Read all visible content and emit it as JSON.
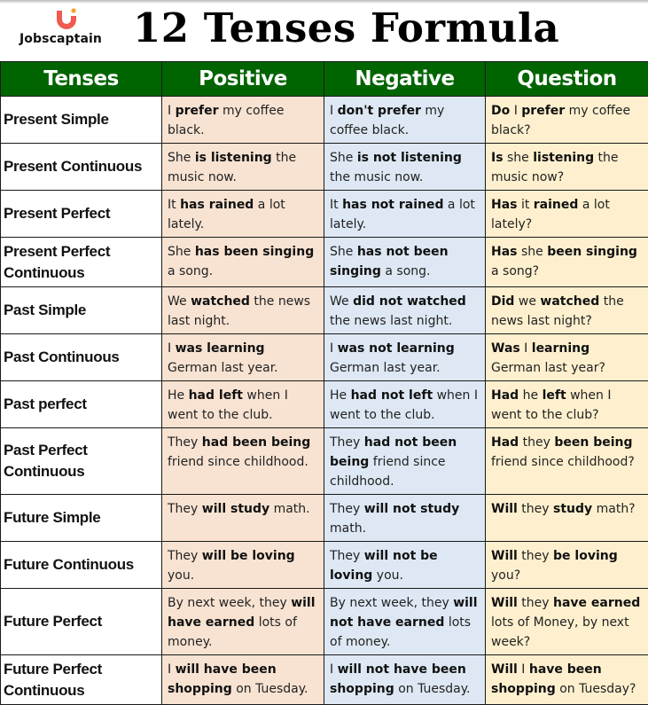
{
  "brand": {
    "name": "Jobscaptain",
    "logo_icon": "jobscaptain-logo-icon",
    "colors": {
      "logo_primary": "#f05a4f",
      "logo_dot": "#f5a623"
    }
  },
  "page": {
    "title": "12 Tenses Formula"
  },
  "colors": {
    "header_bg": "#006400",
    "header_text": "#ffffff",
    "positive_bg": "#f8e3d2",
    "negative_bg": "#dde8f4",
    "question_bg": "#fef0ce"
  },
  "table": {
    "headers": [
      "Tenses",
      "Positive",
      "Negative",
      "Question"
    ],
    "rows": [
      {
        "tense": "Present Simple",
        "positive": [
          {
            "t": "I "
          },
          {
            "b": "prefer"
          },
          {
            "t": " my coffee black."
          }
        ],
        "negative": [
          {
            "t": "I "
          },
          {
            "b": "don't prefer"
          },
          {
            "t": " my coffee black."
          }
        ],
        "question": [
          {
            "b": "Do"
          },
          {
            "t": " I "
          },
          {
            "b": "prefer"
          },
          {
            "t": " my coffee black?"
          }
        ]
      },
      {
        "tense": "Present Continuous",
        "positive": [
          {
            "t": "She "
          },
          {
            "b": "is listening"
          },
          {
            "t": " the music now."
          }
        ],
        "negative": [
          {
            "t": "She "
          },
          {
            "b": "is not listening"
          },
          {
            "t": " the music now."
          }
        ],
        "question": [
          {
            "b": "Is"
          },
          {
            "t": " she "
          },
          {
            "b": "listening"
          },
          {
            "t": " the music now?"
          }
        ]
      },
      {
        "tense": "Present Perfect",
        "positive": [
          {
            "t": "It "
          },
          {
            "b": "has rained"
          },
          {
            "t": " a lot lately."
          }
        ],
        "negative": [
          {
            "t": "It "
          },
          {
            "b": "has not rained"
          },
          {
            "t": " a lot lately."
          }
        ],
        "question": [
          {
            "b": "Has"
          },
          {
            "t": " it "
          },
          {
            "b": "rained"
          },
          {
            "t": " a lot lately?"
          }
        ]
      },
      {
        "tense": "Present Perfect Continuous",
        "positive": [
          {
            "t": "She "
          },
          {
            "b": "has been singing"
          },
          {
            "t": " a song."
          }
        ],
        "negative": [
          {
            "t": "She "
          },
          {
            "b": "has not been singing"
          },
          {
            "t": " a song."
          }
        ],
        "question": [
          {
            "b": "Has"
          },
          {
            "t": " she "
          },
          {
            "b": "been singing"
          },
          {
            "t": " a song?"
          }
        ]
      },
      {
        "tense": "Past Simple",
        "positive": [
          {
            "t": "We "
          },
          {
            "b": "watched"
          },
          {
            "t": " the news last night."
          }
        ],
        "negative": [
          {
            "t": "We "
          },
          {
            "b": "did not watched"
          },
          {
            "t": " the news last night."
          }
        ],
        "question": [
          {
            "b": "Did"
          },
          {
            "t": " we "
          },
          {
            "b": "watched"
          },
          {
            "t": " the news last night?"
          }
        ]
      },
      {
        "tense": "Past Continuous",
        "positive": [
          {
            "t": "I "
          },
          {
            "b": "was learning"
          },
          {
            "t": " German last year."
          }
        ],
        "negative": [
          {
            "t": "I "
          },
          {
            "b": "was not learning"
          },
          {
            "t": " German last year."
          }
        ],
        "question": [
          {
            "b": "Was"
          },
          {
            "t": " I "
          },
          {
            "b": "learning"
          },
          {
            "t": " German last year?"
          }
        ]
      },
      {
        "tense": "Past perfect",
        "positive": [
          {
            "t": "He "
          },
          {
            "b": "had left"
          },
          {
            "t": " when I went to the club."
          }
        ],
        "negative": [
          {
            "t": "He "
          },
          {
            "b": "had not left"
          },
          {
            "t": " when I went to the club."
          }
        ],
        "question": [
          {
            "b": "Had"
          },
          {
            "t": " he "
          },
          {
            "b": "left"
          },
          {
            "t": " when I went to the club?"
          }
        ]
      },
      {
        "tense": "Past Perfect Continuous",
        "positive": [
          {
            "t": "They "
          },
          {
            "b": "had been being"
          },
          {
            "t": " friend since childhood."
          }
        ],
        "negative": [
          {
            "t": "They "
          },
          {
            "b": "had not been being"
          },
          {
            "t": " friend since childhood."
          }
        ],
        "question": [
          {
            "b": "Had"
          },
          {
            "t": " they "
          },
          {
            "b": "been being"
          },
          {
            "t": " friend since childhood?"
          }
        ]
      },
      {
        "tense": "Future Simple",
        "positive": [
          {
            "t": "They "
          },
          {
            "b": "will study"
          },
          {
            "t": " math."
          }
        ],
        "negative": [
          {
            "t": "They "
          },
          {
            "b": "will not study"
          },
          {
            "t": " math."
          }
        ],
        "question": [
          {
            "b": "Will"
          },
          {
            "t": " they "
          },
          {
            "b": "study"
          },
          {
            "t": " math?"
          }
        ]
      },
      {
        "tense": "Future Continuous",
        "positive": [
          {
            "t": "They "
          },
          {
            "b": "will be loving"
          },
          {
            "t": " you."
          }
        ],
        "negative": [
          {
            "t": "They "
          },
          {
            "b": "will not be loving"
          },
          {
            "t": " you."
          }
        ],
        "question": [
          {
            "b": "Will"
          },
          {
            "t": " they "
          },
          {
            "b": "be loving"
          },
          {
            "t": " you?"
          }
        ]
      },
      {
        "tense": "Future Perfect",
        "positive": [
          {
            "t": "By next week, they "
          },
          {
            "b": "will have earned"
          },
          {
            "t": " lots of money."
          }
        ],
        "negative": [
          {
            "t": "By next week, they "
          },
          {
            "b": "will not have earned"
          },
          {
            "t": " lots of money."
          }
        ],
        "question": [
          {
            "b": "Will"
          },
          {
            "t": " they "
          },
          {
            "b": "have earned"
          },
          {
            "t": " lots of Money, by next week?"
          }
        ]
      },
      {
        "tense": "Future Perfect Continuous",
        "positive": [
          {
            "t": "I "
          },
          {
            "b": "will have been shopping"
          },
          {
            "t": " on Tuesday."
          }
        ],
        "negative": [
          {
            "t": "I "
          },
          {
            "b": "will not have been shopping"
          },
          {
            "t": " on Tuesday."
          }
        ],
        "question": [
          {
            "b": "Will"
          },
          {
            "t": " I "
          },
          {
            "b": "have been shopping"
          },
          {
            "t": " on Tuesday?"
          }
        ]
      }
    ]
  }
}
